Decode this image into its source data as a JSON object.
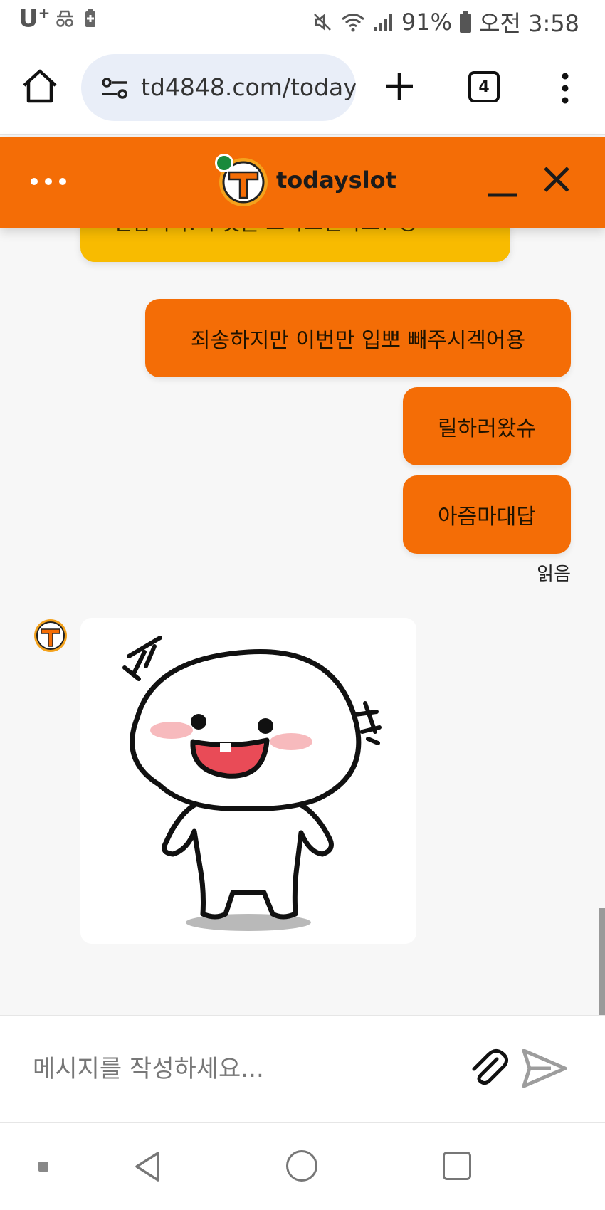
{
  "status_bar": {
    "carrier": "U",
    "carrier_sup": "+",
    "battery": "91%",
    "time": "오전 3:58",
    "icons": [
      "incognito-icon",
      "battery-saver-icon",
      "mute-icon",
      "wifi-icon",
      "signal-icon",
      "battery-icon"
    ]
  },
  "browser": {
    "url": "td4848.com/today",
    "tab_count": "4",
    "icons": [
      "home-icon",
      "site-settings-icon",
      "new-tab-icon",
      "tabs-icon",
      "more-icon"
    ]
  },
  "chat_header": {
    "title": "todayslot",
    "online": true,
    "icons": [
      "more-icon",
      "logo-icon",
      "minimize-icon",
      "close-icon"
    ]
  },
  "messages": {
    "partial_incoming": "편합니다. 무엇을 도와드릴까요? 😊",
    "outgoing": [
      "죄송하지만 이번만 입뽀 빼주시겍어용",
      "릴하러왔슈",
      "아즘마대답"
    ],
    "read_status": "읽음",
    "sticker_icon": "laughing-character-sticker"
  },
  "composer": {
    "placeholder": "메시지를 작성하세요...",
    "icons": [
      "paperclip-icon",
      "send-icon"
    ]
  },
  "colors": {
    "brand_orange": "#f46d06",
    "yellow_bubble": "#f8bb00",
    "online_green": "#1a8a3c",
    "chat_background": "#f7f7f7"
  }
}
